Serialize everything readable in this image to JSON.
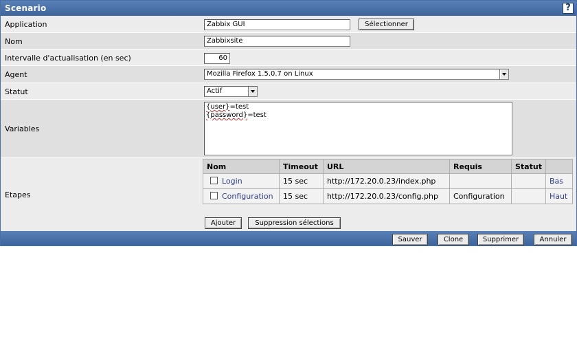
{
  "header": {
    "title": "Scenario",
    "help_label": "?"
  },
  "form": {
    "application": {
      "label": "Application",
      "value": "Zabbix GUI",
      "select_button": "Sélectionner"
    },
    "nom": {
      "label": "Nom",
      "value": "Zabbixsite"
    },
    "interval": {
      "label": "Intervalle d'actualisation (en sec)",
      "value": "60"
    },
    "agent": {
      "label": "Agent",
      "value": "Mozilla Firefox 1.5.0.7 on Linux"
    },
    "statut": {
      "label": "Statut",
      "value": "Actif"
    },
    "variables": {
      "label": "Variables",
      "lines": [
        {
          "macro": "{user}",
          "rest": "=test"
        },
        {
          "macro": "{password}",
          "rest": "=test"
        }
      ]
    },
    "etapes": {
      "label": "Etapes",
      "columns": [
        "Nom",
        "Timeout",
        "URL",
        "Requis",
        "Statut",
        ""
      ],
      "rows": [
        {
          "nom": "Login",
          "timeout": "15 sec",
          "url": "http://172.20.0.23/index.php",
          "requis": "",
          "statut": "",
          "move": "Bas"
        },
        {
          "nom": "Configuration",
          "timeout": "15 sec",
          "url": "http://172.20.0.23/config.php",
          "requis": "Configuration",
          "statut": "",
          "move": "Haut"
        }
      ],
      "add_button": "Ajouter",
      "delete_button": "Suppression sélections"
    }
  },
  "footer": {
    "save": "Sauver",
    "clone": "Clone",
    "delete": "Supprimer",
    "cancel": "Annuler"
  }
}
